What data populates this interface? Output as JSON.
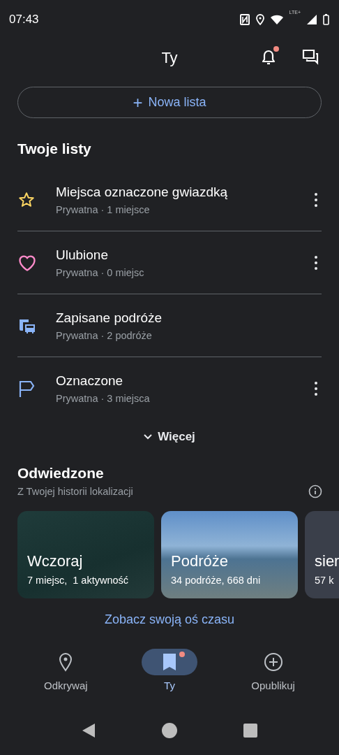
{
  "status_bar": {
    "time": "07:43",
    "network": "LTE+"
  },
  "header": {
    "title": "Ty",
    "notifications_badge": true
  },
  "new_list_button": {
    "icon": "+",
    "label": "Nowa lista"
  },
  "lists_section": {
    "title": "Twoje listy",
    "items": [
      {
        "kind": "star",
        "title": "Miejsca oznaczone gwiazdką",
        "subtitle": "Prywatna · 1 miejsce",
        "has_menu": true
      },
      {
        "kind": "heart",
        "title": "Ulubione",
        "subtitle": "Prywatna · 0 miejsc",
        "has_menu": true
      },
      {
        "kind": "trips",
        "title": "Zapisane podróże",
        "subtitle": "Prywatna · 2 podróże",
        "has_menu": false
      },
      {
        "kind": "flag",
        "title": "Oznaczone",
        "subtitle": "Prywatna · 3 miejsca",
        "has_menu": true
      }
    ],
    "more_button": "Więcej"
  },
  "visited_section": {
    "title": "Odwiedzone",
    "subtitle": "Z Twojej historii lokalizacji",
    "cards": [
      {
        "kind": "map",
        "title": "Wczoraj",
        "subtitle": "7 miejsc,  1 aktywność"
      },
      {
        "kind": "photo",
        "title": "Podróże",
        "subtitle": "34 podróże, 668 dni"
      },
      {
        "kind": "chart",
        "title": "sier",
        "subtitle": "57 k"
      }
    ],
    "timeline_link": "Zobacz swoją oś czasu"
  },
  "bottom_nav": [
    {
      "kind": "pin",
      "label": "Odkrywaj",
      "selected": false,
      "badge": false
    },
    {
      "kind": "bookmark",
      "label": "Ty",
      "selected": true,
      "badge": true
    },
    {
      "kind": "add",
      "label": "Opublikuj",
      "selected": false,
      "badge": false
    }
  ]
}
